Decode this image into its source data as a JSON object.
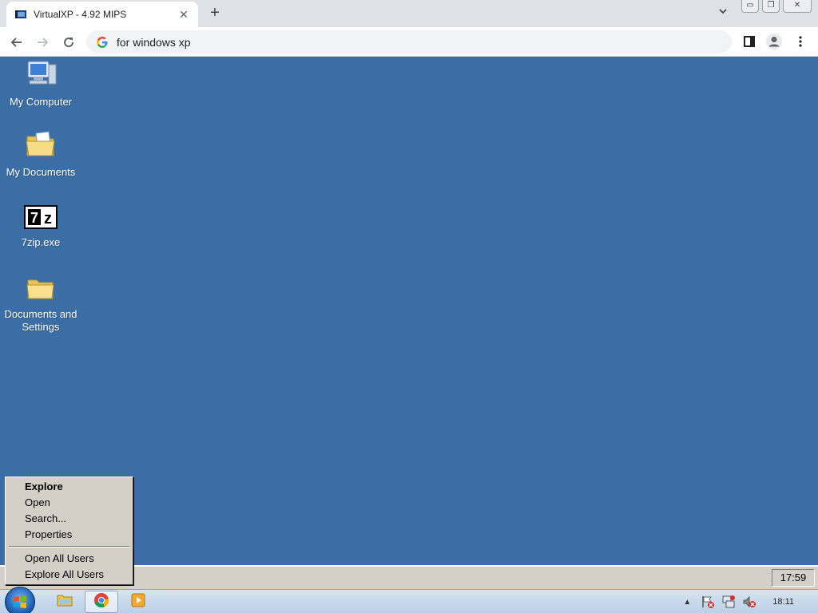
{
  "browser": {
    "tab_title": "VirtualXP - 4.92 MIPS",
    "tab_close": "✕",
    "new_tab": "+",
    "address": "for windows xp",
    "window_buttons": {
      "minimize": "▭",
      "restore": "❐",
      "close": "✕"
    }
  },
  "desktop": {
    "background_color": "#3a6ea5",
    "icons": [
      {
        "label": "My Computer",
        "icon": "computer-icon"
      },
      {
        "label": "My Documents",
        "icon": "documents-folder-icon"
      },
      {
        "label": "7zip.exe",
        "icon": "7zip-icon",
        "glyph": "7z"
      },
      {
        "label": "Documents and Settings",
        "icon": "folder-icon"
      }
    ]
  },
  "context_menu": {
    "items": [
      "Explore",
      "Open",
      "Search...",
      "Properties"
    ],
    "items2": [
      "Open All Users",
      "Explore All Users"
    ]
  },
  "vm_taskbar": {
    "clock": "17:59"
  },
  "host_taskbar": {
    "clock": "18:11",
    "tray_arrow": "▲"
  }
}
